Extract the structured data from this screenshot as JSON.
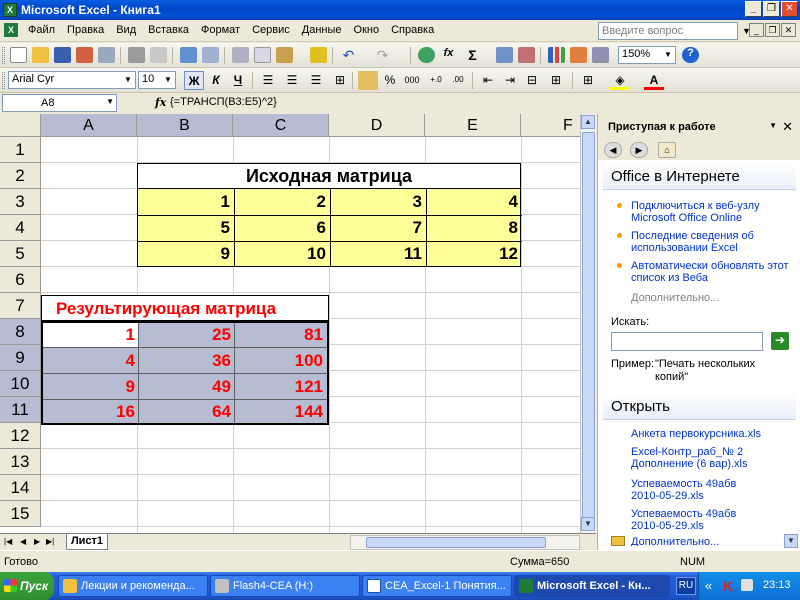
{
  "window": {
    "title": "Microsoft Excel - Книга1",
    "app_icon": "X"
  },
  "menu": [
    "Файл",
    "Правка",
    "Вид",
    "Вставка",
    "Формат",
    "Сервис",
    "Данные",
    "Окно",
    "Справка"
  ],
  "ask_placeholder": "Введите вопрос",
  "toolbar": {
    "zoom": "150%",
    "font_name": "Arial Cyr",
    "font_size": "10",
    "bold": "Ж",
    "italic": "К",
    "underline": "Ч",
    "percent": "%",
    "thousands": "000",
    "sigma": "Σ",
    "fx": "fx"
  },
  "formula_bar": {
    "name_box": "A8",
    "fx": "fx",
    "formula": "{=ТРАНСП(B3:E5)^2}"
  },
  "columns": [
    "A",
    "B",
    "C",
    "D",
    "E",
    "F"
  ],
  "rows": [
    "1",
    "2",
    "3",
    "4",
    "5",
    "6",
    "7",
    "8",
    "9",
    "10",
    "11",
    "12",
    "13",
    "14",
    "15"
  ],
  "source_matrix": {
    "title": "Исходная матрица",
    "rows": [
      [
        "1",
        "2",
        "3",
        "4"
      ],
      [
        "5",
        "6",
        "7",
        "8"
      ],
      [
        "9",
        "10",
        "11",
        "12"
      ]
    ]
  },
  "result_matrix": {
    "title": "Результирующая матрица",
    "rows": [
      [
        "1",
        "25",
        "81"
      ],
      [
        "4",
        "36",
        "100"
      ],
      [
        "9",
        "49",
        "121"
      ],
      [
        "16",
        "64",
        "144"
      ]
    ]
  },
  "sheet_tab": "Лист1",
  "task_pane": {
    "title": "Приступая к работе",
    "office_section": "Office в Интернете",
    "links": [
      "Подключиться к веб-узлу Microsoft Office Online",
      "Последние сведения об использовании Excel",
      "Автоматически обновлять этот список из Веба"
    ],
    "more": "Дополнительно...",
    "search_label": "Искать:",
    "example_label": "Пример:",
    "example_value": "\"Печать нескольких копий\"",
    "open_section": "Открыть",
    "files": [
      "Анкета первокурсника.xls",
      "Excel-Контр_раб_№ 2 Дополнение (6 вар).xls",
      "Успеваемость 49абв 2010-05-29.xls",
      "Успеваемость 49абв 2010-05-29.xls"
    ],
    "more_open": "Дополнительно..."
  },
  "status": {
    "ready": "Готово",
    "sum": "Сумма=650",
    "num": "NUM"
  },
  "taskbar": {
    "start": "Пуск",
    "tasks": [
      "Лекции и рекоменда...",
      "Flash4-CEA (H:)",
      "CEA_Excel-1 Понятия...",
      "Microsoft Excel - Кн..."
    ],
    "lang": "RU",
    "tray_chevron": "«",
    "clock": "23:13"
  }
}
